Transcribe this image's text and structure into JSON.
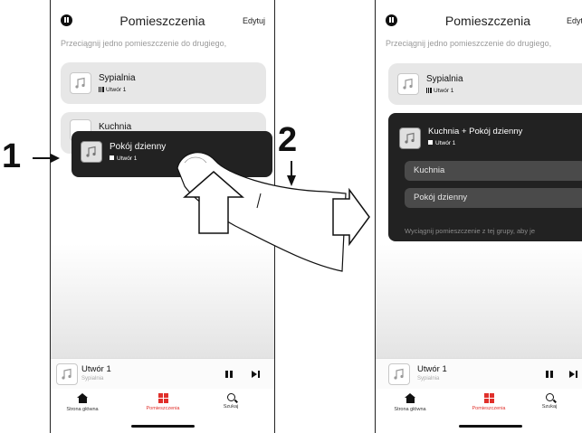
{
  "annotations": {
    "step1": "1",
    "step2": "2"
  },
  "left_screen": {
    "header": {
      "title": "Pomieszczenia",
      "edit_label": "Edytuj"
    },
    "hint": "Przeciągnij jedno pomieszczenie do drugiego,",
    "rooms": [
      {
        "name": "Sypialnia",
        "track": "Utwór 1"
      },
      {
        "name": "Kuchnia"
      }
    ],
    "dragged_room": {
      "name": "Pokój dzienny",
      "track": "Utwór 1"
    },
    "player": {
      "title": "Utwór 1",
      "subtitle": "Sypialnia"
    },
    "tabs": [
      {
        "label": "Strona główna",
        "icon": "home-icon"
      },
      {
        "label": "Pomieszczenia",
        "icon": "rooms-icon",
        "active": true
      },
      {
        "label": "Szukaj",
        "icon": "search-icon"
      }
    ]
  },
  "right_screen": {
    "header": {
      "title": "Pomieszczenia",
      "edit_label": "Edytuj"
    },
    "hint": "Przeciągnij jedno pomieszczenie do drugiego,",
    "rooms": [
      {
        "name": "Sypialnia",
        "track": "Utwór 1"
      }
    ],
    "group": {
      "name": "Kuchnia + Pokój dzienny",
      "track": "Utwór 1",
      "members": [
        "Kuchnia",
        "Pokój dzienny"
      ],
      "footer": "Wyciągnij pomieszczenie z tej grupy, aby je"
    },
    "player": {
      "title": "Utwór 1",
      "subtitle": "Sypialnia"
    },
    "tabs": [
      {
        "label": "Strona główna",
        "icon": "home-icon"
      },
      {
        "label": "Pomieszczenia",
        "icon": "rooms-icon",
        "active": true
      },
      {
        "label": "Szukaj",
        "icon": "search-icon"
      }
    ]
  },
  "colors": {
    "accent": "#e0302b",
    "dark_card": "#222222",
    "card": "#e7e7e7"
  }
}
